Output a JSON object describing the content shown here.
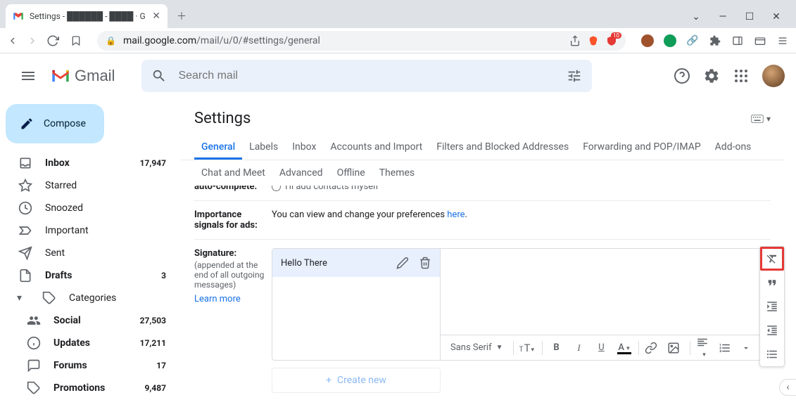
{
  "browser": {
    "tab_title": "Settings - ██████ - ████ · G",
    "url_host": "mail.google.com",
    "url_path": "/mail/u/0/#settings/general",
    "ext_badge": "10"
  },
  "header": {
    "logo_text": "Gmail",
    "search_placeholder": "Search mail"
  },
  "compose_label": "Compose",
  "sidebar": [
    {
      "icon": "inbox",
      "label": "Inbox",
      "count": "17,947",
      "bold": true
    },
    {
      "icon": "star",
      "label": "Starred",
      "count": ""
    },
    {
      "icon": "clock",
      "label": "Snoozed",
      "count": ""
    },
    {
      "icon": "important",
      "label": "Important",
      "count": ""
    },
    {
      "icon": "send",
      "label": "Sent",
      "count": ""
    },
    {
      "icon": "draft",
      "label": "Drafts",
      "count": "3",
      "bold": true
    },
    {
      "icon": "label",
      "label": "Categories",
      "count": "",
      "expandable": true
    }
  ],
  "categories": [
    {
      "icon": "social",
      "label": "Social",
      "count": "27,503",
      "bold": true
    },
    {
      "icon": "info",
      "label": "Updates",
      "count": "17,211",
      "bold": true
    },
    {
      "icon": "forum",
      "label": "Forums",
      "count": "17",
      "bold": true
    },
    {
      "icon": "tag",
      "label": "Promotions",
      "count": "9,487",
      "bold": true
    }
  ],
  "settings": {
    "title": "Settings",
    "tabs_row1": [
      "General",
      "Labels",
      "Inbox",
      "Accounts and Import",
      "Filters and Blocked Addresses",
      "Forwarding and POP/IMAP",
      "Add-ons"
    ],
    "tabs_row2": [
      "Chat and Meet",
      "Advanced",
      "Offline",
      "Themes"
    ],
    "active_tab": "General",
    "autocomplete": {
      "label": "auto-complete:",
      "option": "I'll add contacts myself"
    },
    "importance": {
      "label1": "Importance",
      "label2": "signals for ads:",
      "text": "You can view and change your preferences ",
      "link": "here",
      "after": "."
    },
    "signature": {
      "label": "Signature:",
      "sub": "(appended at the end of all outgoing messages)",
      "learn": "Learn more",
      "selected_name": "Hello There",
      "font": "Sans Serif",
      "create": "Create new"
    }
  },
  "format_panel": [
    "remove-format",
    "quote",
    "indent-increase",
    "indent-decrease",
    "bulleted-list"
  ]
}
